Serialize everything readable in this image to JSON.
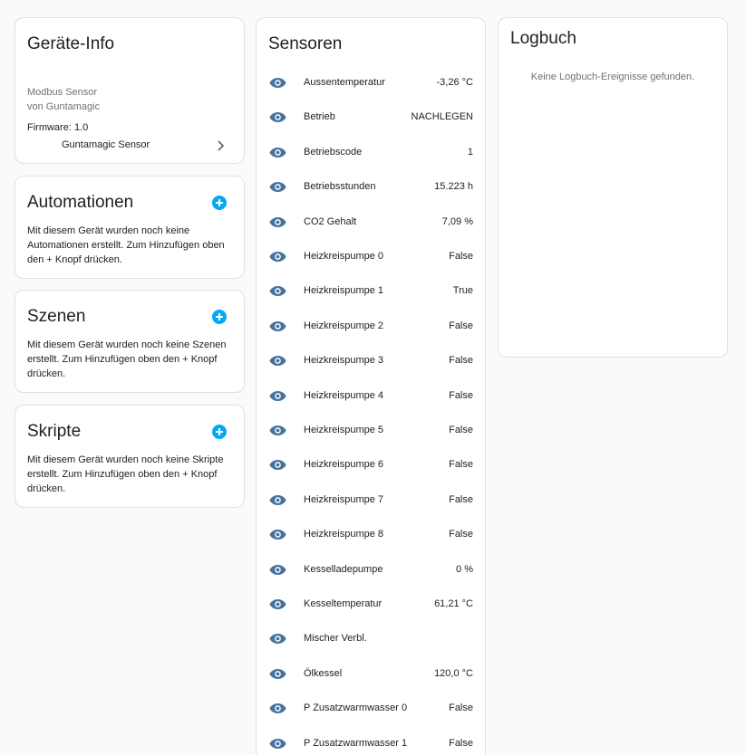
{
  "device_info": {
    "title": "Geräte-Info",
    "model": "Modbus Sensor",
    "manufacturer": "von Guntamagic",
    "firmware": "Firmware: 1.0",
    "link_label": "Guntamagic Sensor",
    "link_icon": "chevron-right-icon"
  },
  "automations": {
    "title": "Automationen",
    "text": "Mit diesem Gerät wurden noch keine Automationen erstellt. Zum Hinzufügen oben den + Knopf drücken.",
    "add_icon": "plus-circle-icon"
  },
  "scenes": {
    "title": "Szenen",
    "text": "Mit diesem Gerät wurden noch keine Szenen erstellt. Zum Hinzufügen oben den + Knopf drücken.",
    "add_icon": "plus-circle-icon"
  },
  "scripts": {
    "title": "Skripte",
    "text": "Mit diesem Gerät wurden noch keine Skripte erstellt. Zum Hinzufügen oben den + Knopf drücken.",
    "add_icon": "plus-circle-icon"
  },
  "sensors": {
    "title": "Sensoren",
    "icon": "eye-icon",
    "items": [
      {
        "name": "Aussentemperatur",
        "value": "-3,26 °C"
      },
      {
        "name": "Betrieb",
        "value": "NACHLEGEN"
      },
      {
        "name": "Betriebscode",
        "value": "1"
      },
      {
        "name": "Betriebsstunden",
        "value": "15.223 h"
      },
      {
        "name": "CO2 Gehalt",
        "value": "7,09 %"
      },
      {
        "name": "Heizkreispumpe 0",
        "value": "False"
      },
      {
        "name": "Heizkreispumpe 1",
        "value": "True"
      },
      {
        "name": "Heizkreispumpe 2",
        "value": "False"
      },
      {
        "name": "Heizkreispumpe 3",
        "value": "False"
      },
      {
        "name": "Heizkreispumpe 4",
        "value": "False"
      },
      {
        "name": "Heizkreispumpe 5",
        "value": "False"
      },
      {
        "name": "Heizkreispumpe 6",
        "value": "False"
      },
      {
        "name": "Heizkreispumpe 7",
        "value": "False"
      },
      {
        "name": "Heizkreispumpe 8",
        "value": "False"
      },
      {
        "name": "Kesselladepumpe",
        "value": "0 %"
      },
      {
        "name": "Kesseltemperatur",
        "value": "61,21 °C"
      },
      {
        "name": "Mischer Verbl.",
        "value": ""
      },
      {
        "name": "Ölkessel",
        "value": "120,0 °C"
      },
      {
        "name": "P Zusatzwarmwasser 0",
        "value": "False"
      },
      {
        "name": "P Zusatzwarmwasser 1",
        "value": "False"
      }
    ]
  },
  "logbook": {
    "title": "Logbuch",
    "empty_text": "Keine Logbuch-Ereignisse gefunden."
  },
  "colors": {
    "accent": "#03a9f4",
    "icon": "#44739e",
    "secondary_text": "#727272"
  }
}
